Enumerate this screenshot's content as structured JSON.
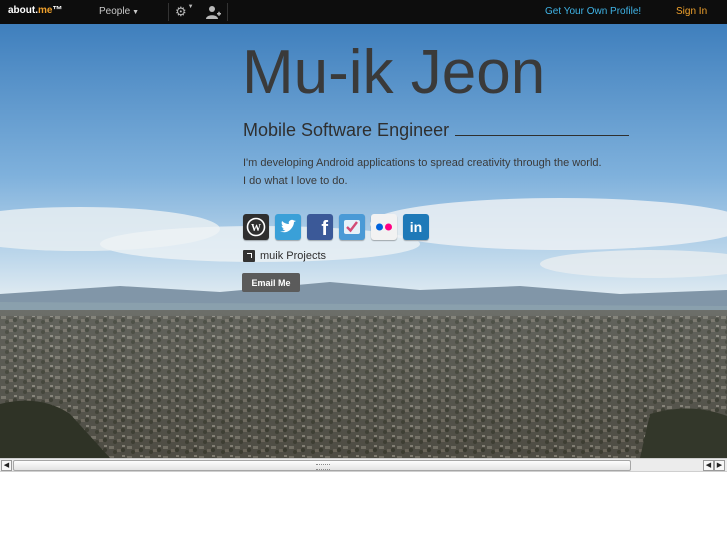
{
  "topbar": {
    "logo_text": "about.",
    "logo_accent": "me",
    "logo_tm": "™",
    "people_label": "People",
    "get_profile_label": "Get Your Own Profile!",
    "sign_in_label": "Sign In"
  },
  "profile": {
    "name": "Mu-ik Jeon",
    "headline": "Mobile Software Engineer",
    "bio_line1": "I'm developing Android applications to spread creativity through the world.",
    "bio_line2": "I do what I love to do.",
    "link_label": "muik Projects",
    "email_button": "Email Me"
  },
  "socials": [
    {
      "name": "wordpress-icon",
      "glyph": "W",
      "color": "#2f2f2f"
    },
    {
      "name": "twitter-icon",
      "glyph": "t",
      "color": "#3aa0d8"
    },
    {
      "name": "facebook-icon",
      "glyph": "f",
      "color": "#3b5998"
    },
    {
      "name": "foursquare-icon",
      "glyph": "✔",
      "color": "#4a9ad6"
    },
    {
      "name": "flickr-icon",
      "glyph": "••",
      "color": "#f2f2f2"
    },
    {
      "name": "linkedin-icon",
      "glyph": "in",
      "color": "#1e79b8"
    }
  ],
  "colors": {
    "accent_orange": "#f0a12c",
    "link_blue": "#3fb3e6",
    "topbar_bg": "#0d0d0d"
  }
}
